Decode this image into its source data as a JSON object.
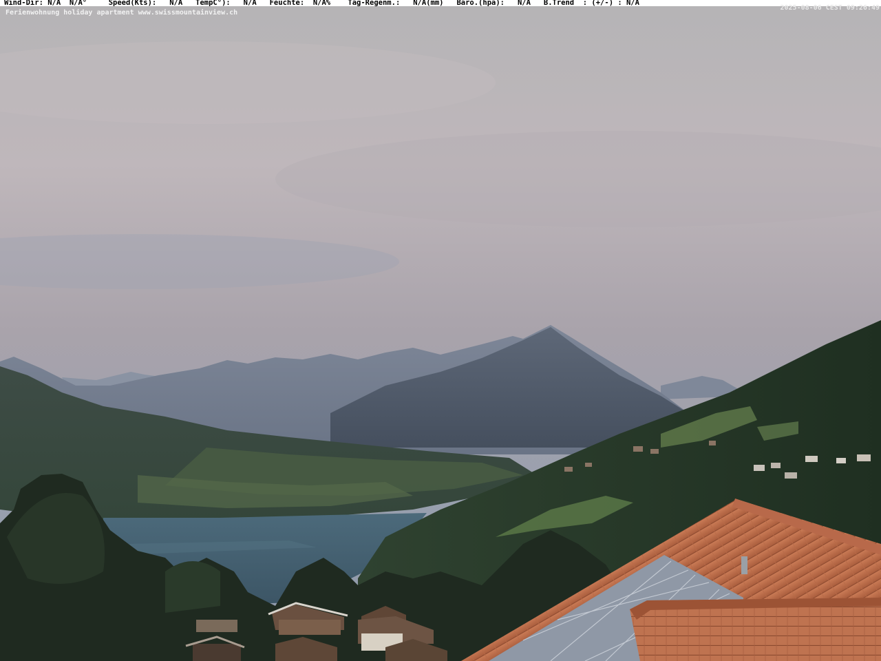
{
  "overlay": {
    "weather_line": "Wind-Dir: N/A  N/A°     Speed(Kts):   N/A   TempC°):   N/A   Feuchte:  N/A%    Tag-Regenm.:   N/A(mm)   Baro.(hpa):   N/A   B.Trend  : (+/-) : N/A",
    "subtitle": "Ferienwohnung holiday apartment www.swissmountainview.ch",
    "timestamp": "2025-08-06 CEST 09:26:49"
  }
}
